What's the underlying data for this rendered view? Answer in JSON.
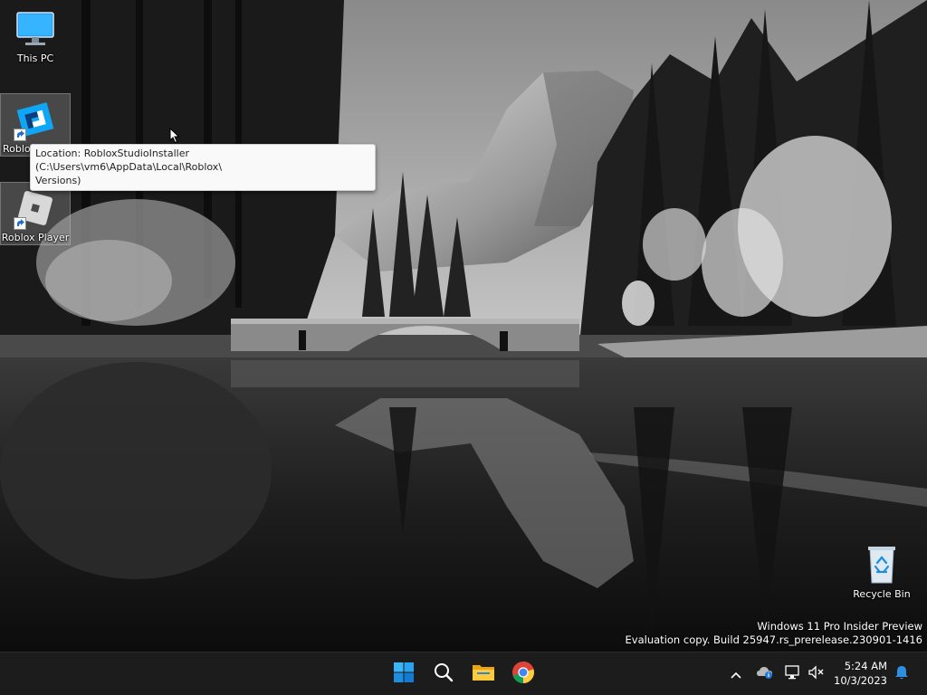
{
  "desktop": {
    "icons": [
      {
        "label": "This PC",
        "icon": "monitor-icon"
      },
      {
        "label": "Roblox",
        "icon": "roblox-studio-icon"
      },
      {
        "label": "Roblox Player",
        "icon": "roblox-player-icon"
      },
      {
        "label": "Recycle Bin",
        "icon": "recycle-bin-icon"
      }
    ],
    "tooltip": {
      "line1": "Location: RobloxStudioInstaller (C:\\Users\\vm6\\AppData\\Local\\Roblox\\",
      "line2": "Versions)"
    }
  },
  "watermark": {
    "line1": "Windows 11 Pro Insider Preview",
    "line2": "Evaluation copy. Build 25947.rs_prerelease.230901-1416"
  },
  "taskbar": {
    "apps": [
      "start-icon",
      "search-icon",
      "file-explorer-icon",
      "chrome-icon"
    ],
    "tray": [
      "chevron-up-icon",
      "onedrive-icon",
      "network-icon",
      "volume-muted-icon",
      "notification-bell-icon"
    ],
    "clock": {
      "time": "5:24 AM",
      "date": "10/3/2023"
    }
  },
  "colors": {
    "taskbar_bg": "#1c1c1c",
    "windows_blue": "#0a7cd6",
    "accent_notify": "#2e8fe0"
  }
}
